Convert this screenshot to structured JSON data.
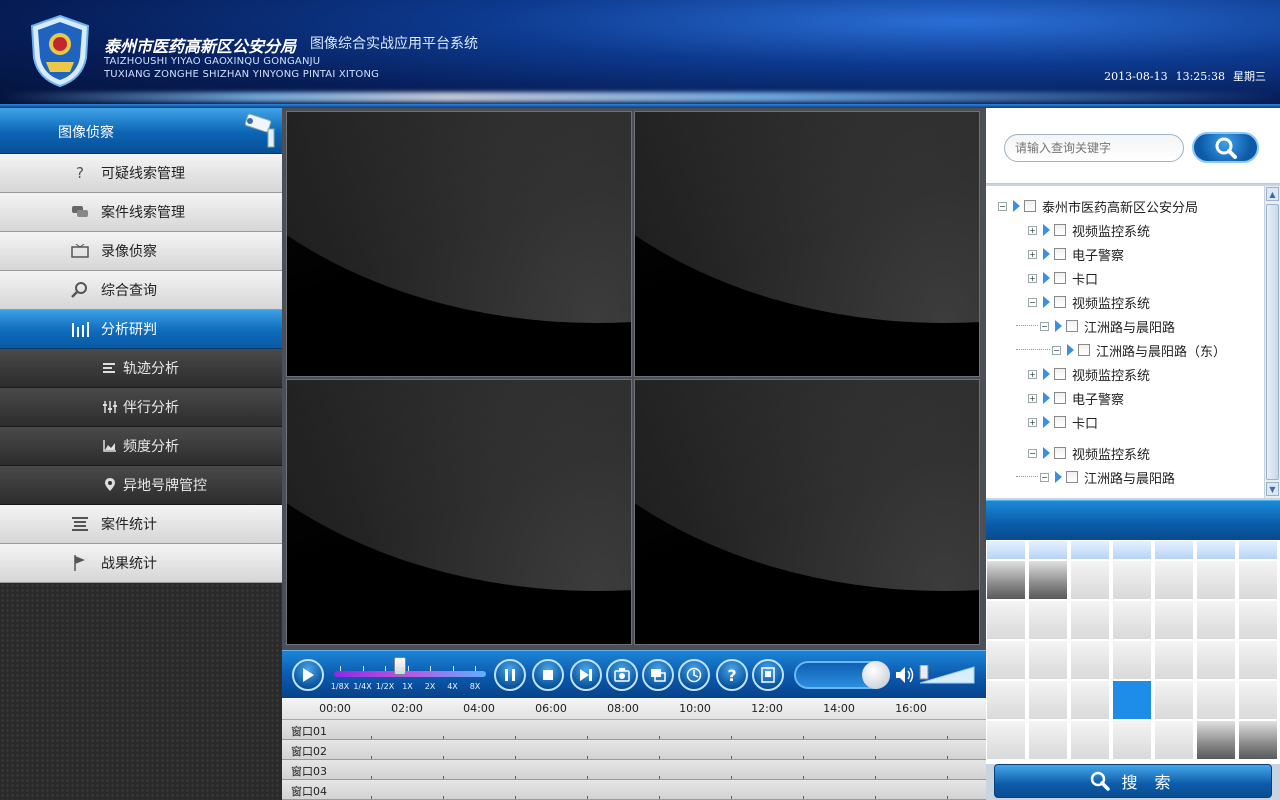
{
  "header": {
    "title": "泰州市医药高新区公安分局",
    "subtitle": "图像综合实战应用平台系统",
    "en_line1": "TAIZHOUSHI YIYAO GAOXINQU GONGANJU",
    "en_line2": "TUXIANG ZONGHE SHIZHAN YINYONG PINTAI XITONG",
    "date": "2013-08-13",
    "time": "13:25:38",
    "weekday": "星期三"
  },
  "sidebar": {
    "title": "图像侦察",
    "items": [
      {
        "label": "可疑线索管理",
        "icon": "question-icon"
      },
      {
        "label": "案件线索管理",
        "icon": "chat-icon"
      },
      {
        "label": "录像侦察",
        "icon": "tv-icon"
      },
      {
        "label": "综合查询",
        "icon": "magnifier-icon"
      },
      {
        "label": "分析研判",
        "icon": "bars-icon",
        "active": true
      }
    ],
    "subitems": [
      {
        "label": "轨迹分析",
        "icon": "list-icon"
      },
      {
        "label": "伴行分析",
        "icon": "sliders-icon"
      },
      {
        "label": "频度分析",
        "icon": "chart-icon"
      },
      {
        "label": "异地号牌管控",
        "icon": "pin-icon"
      }
    ],
    "items_after": [
      {
        "label": "案件统计",
        "icon": "lines-icon"
      },
      {
        "label": "战果统计",
        "icon": "flag-icon"
      }
    ]
  },
  "controls": {
    "speed_labels": [
      "1/8X",
      "1/4X",
      "1/2X",
      "1X",
      "2X",
      "4X",
      "8X"
    ],
    "speed_selected": "1X",
    "help_symbol": "?",
    "volume_level": 0.85
  },
  "timeline": {
    "hours": [
      "00:00",
      "02:00",
      "04:00",
      "06:00",
      "08:00",
      "10:00",
      "12:00",
      "14:00",
      "16:00"
    ],
    "windows": [
      "窗口01",
      "窗口02",
      "窗口03",
      "窗口04"
    ]
  },
  "right": {
    "search_placeholder": "请输入查询关键字",
    "tree": [
      {
        "label": "泰州市医药高新区公安分局",
        "level": 0,
        "expanded": true
      },
      {
        "label": "视频监控系统",
        "level": 1,
        "expanded": false
      },
      {
        "label": "电子警察",
        "level": 1,
        "expanded": false
      },
      {
        "label": "卡口",
        "level": 1,
        "expanded": false
      },
      {
        "label": "视频监控系统",
        "level": 1,
        "expanded": true
      },
      {
        "label": "江洲路与晨阳路",
        "level": 2,
        "expanded": true
      },
      {
        "label": "江洲路与晨阳路（东）",
        "level": 3,
        "expanded": true
      },
      {
        "label": "视频监控系统",
        "level": 1,
        "expanded": false
      },
      {
        "label": "电子警察",
        "level": 1,
        "expanded": false
      },
      {
        "label": "卡口",
        "level": 1,
        "expanded": false
      },
      {
        "label": "视频监控系统",
        "level": 1,
        "expanded": true
      },
      {
        "label": "江洲路与晨阳路",
        "level": 2,
        "expanded": true
      }
    ],
    "search_button": "搜 索"
  }
}
